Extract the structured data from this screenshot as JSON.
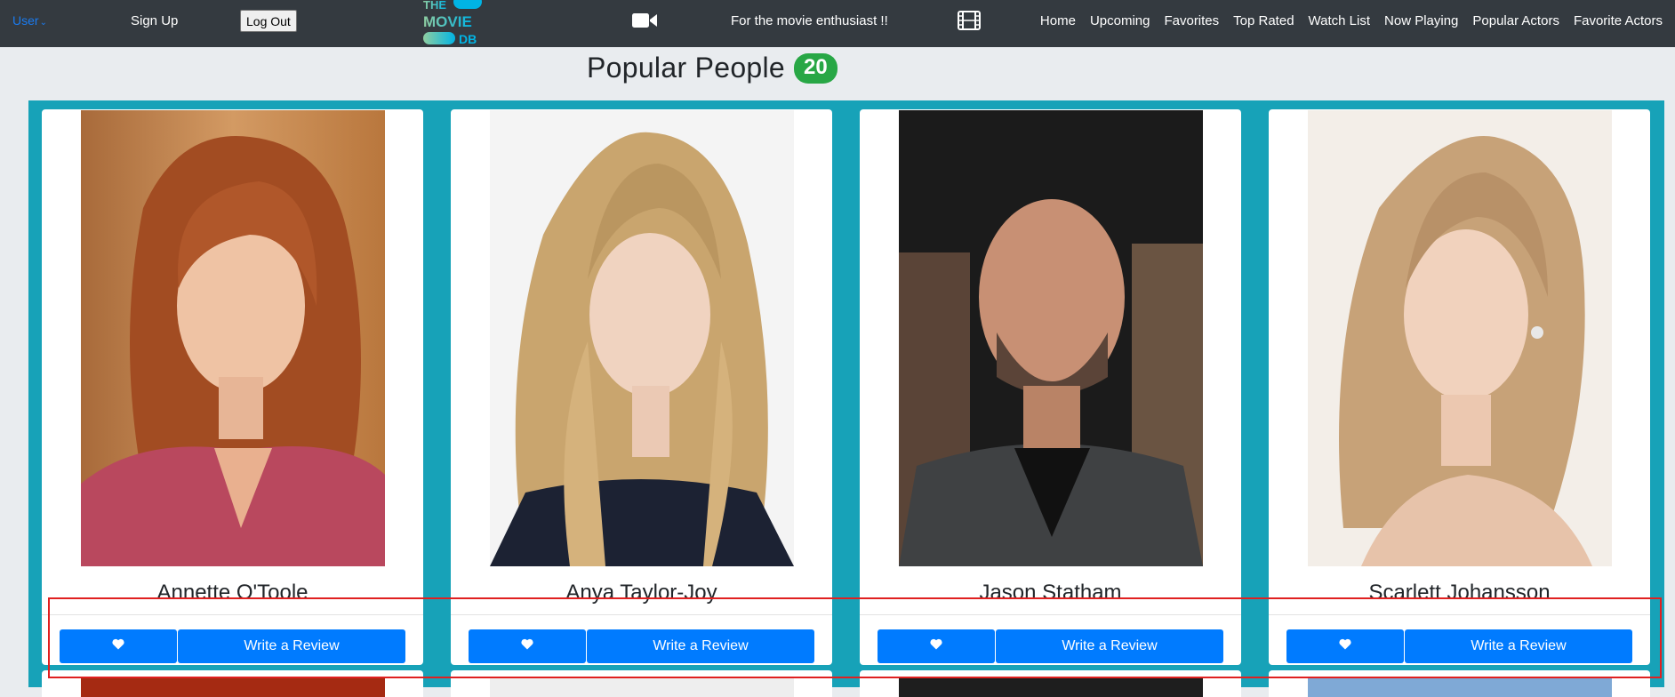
{
  "navbar": {
    "user_label": "User",
    "signup_label": "Sign Up",
    "logout_label": "Log Out",
    "logo_lines": [
      "THE",
      "MOVIE",
      "DB"
    ],
    "tagline": "For the movie enthusiast !!",
    "links": [
      "Home",
      "Upcoming",
      "Favorites",
      "Top Rated",
      "Watch List",
      "Now Playing",
      "Popular Actors",
      "Favorite Actors"
    ]
  },
  "heading": {
    "title": "Popular People",
    "count": "20"
  },
  "people": [
    {
      "name": "Annette O'Toole",
      "review_label": "Write a Review"
    },
    {
      "name": "Anya Taylor-Joy",
      "review_label": "Write a Review"
    },
    {
      "name": "Jason Statham",
      "review_label": "Write a Review"
    },
    {
      "name": "Scarlett Johansson",
      "review_label": "Write a Review"
    }
  ],
  "colors": {
    "navbar_bg": "#343a40",
    "page_bg": "#e9ecef",
    "cards_area_bg": "#17a2b8",
    "button_primary": "#007bff",
    "badge_success": "#28a745",
    "highlight": "#e02020"
  },
  "icons": {
    "camera": "video-camera-icon",
    "film": "film-icon",
    "heart": "heart-icon"
  }
}
